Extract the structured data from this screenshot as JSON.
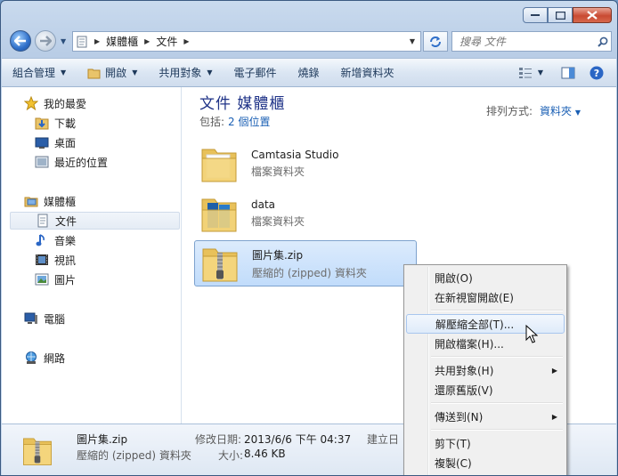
{
  "window": {
    "caption": {
      "minimize": "–",
      "maximize": "□",
      "close": "✕"
    }
  },
  "address": {
    "segments": [
      "媒體櫃",
      "文件"
    ]
  },
  "search": {
    "placeholder": "搜尋 文件"
  },
  "toolbar": {
    "organize": "組合管理",
    "open": "開啟",
    "share": "共用對象",
    "email": "電子郵件",
    "burn": "燒錄",
    "new_folder": "新增資料夾"
  },
  "nav": {
    "favorites": "我的最愛",
    "downloads": "下載",
    "desktop": "桌面",
    "recent": "最近的位置",
    "libraries": "媒體櫃",
    "documents": "文件",
    "music": "音樂",
    "videos": "視訊",
    "pictures": "圖片",
    "computer": "電腦",
    "network": "網路"
  },
  "library": {
    "title": "文件 媒體櫃",
    "includes_label": "包括:",
    "includes_link": "2 個位置",
    "sort_label": "排列方式:",
    "sort_value": "資料夾"
  },
  "files": [
    {
      "name": "Camtasia Studio",
      "type": "檔案資料夾"
    },
    {
      "name": "data",
      "type": "檔案資料夾"
    },
    {
      "name": "圖片集.zip",
      "type": "壓縮的 (zipped) 資料夾"
    }
  ],
  "details": {
    "name": "圖片集.zip",
    "type": "壓縮的 (zipped) 資料夾",
    "modified_label": "修改日期:",
    "modified_value": "2013/6/6 下午 04:37",
    "created_label": "建立日",
    "size_label": "大小:",
    "size_value": "8.46 KB"
  },
  "context_menu": {
    "open": "開啟(O)",
    "open_new_window": "在新視窗開啟(E)",
    "extract_all": "解壓縮全部(T)...",
    "open_archive": "開啟檔案(H)...",
    "share_with": "共用對象(H)",
    "restore_previous": "還原舊版(V)",
    "send_to": "傳送到(N)",
    "cut": "剪下(T)",
    "copy": "複製(C)"
  },
  "colors": {
    "title_text": "#1e3287",
    "link": "#1a5fb4",
    "selection": "#c1dcfb",
    "close_button": "#c94a33"
  }
}
